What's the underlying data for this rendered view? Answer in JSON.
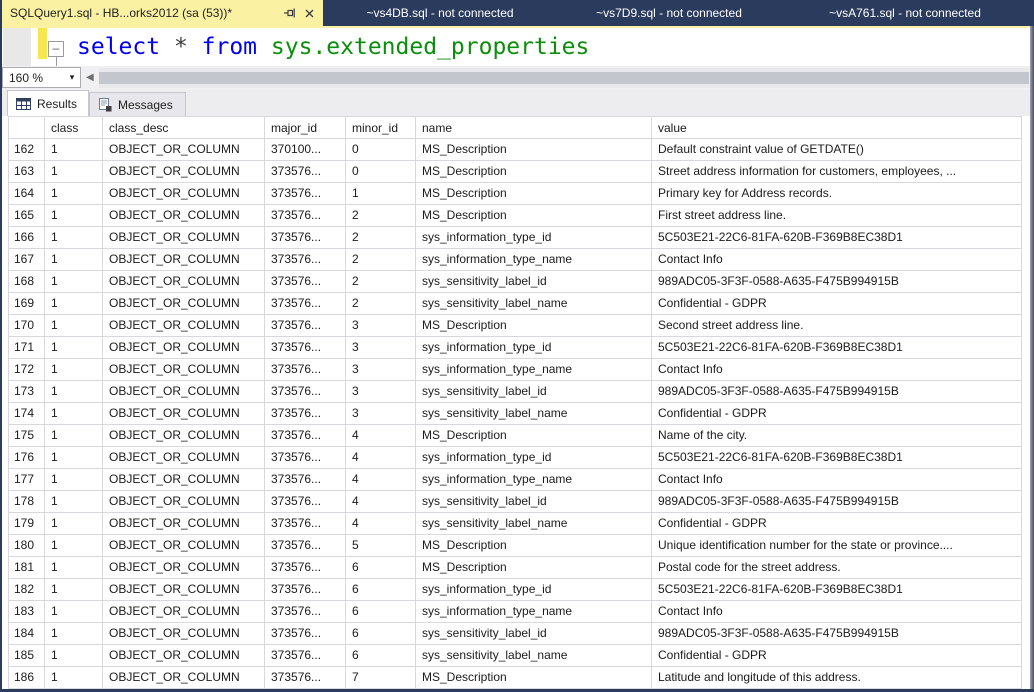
{
  "tab_bar": {
    "tabs": [
      {
        "label": "SQLQuery1.sql - HB...orks2012 (sa (53))*",
        "active": true
      },
      {
        "label": "~vs4DB.sql - not connected",
        "active": false
      },
      {
        "label": "~vs7D9.sql - not connected",
        "active": false
      },
      {
        "label": "~vsA761.sql - not connected",
        "active": false
      }
    ]
  },
  "editor": {
    "code_tokens": {
      "kw_select": "select",
      "star": " * ",
      "kw_from": "from",
      "space": " ",
      "system_object": "sys.extended_properties"
    },
    "zoom_value": "160 %"
  },
  "glyphs": {
    "dropdown_arrow": "▾",
    "scroll_left_arrow": "◀",
    "outline_collapse": "–"
  },
  "results_pane": {
    "results_tab_label": "Results",
    "messages_tab_label": "Messages"
  },
  "grid": {
    "columns": [
      "class",
      "class_desc",
      "major_id",
      "minor_id",
      "name",
      "value"
    ],
    "rows": [
      {
        "num": "162",
        "cells": [
          "1",
          "OBJECT_OR_COLUMN",
          "370100...",
          "0",
          "MS_Description",
          "Default constraint value of GETDATE()"
        ]
      },
      {
        "num": "163",
        "cells": [
          "1",
          "OBJECT_OR_COLUMN",
          "373576...",
          "0",
          "MS_Description",
          "Street address information for customers, employees, ..."
        ]
      },
      {
        "num": "164",
        "cells": [
          "1",
          "OBJECT_OR_COLUMN",
          "373576...",
          "1",
          "MS_Description",
          "Primary key for Address records."
        ]
      },
      {
        "num": "165",
        "cells": [
          "1",
          "OBJECT_OR_COLUMN",
          "373576...",
          "2",
          "MS_Description",
          "First street address line."
        ]
      },
      {
        "num": "166",
        "cells": [
          "1",
          "OBJECT_OR_COLUMN",
          "373576...",
          "2",
          "sys_information_type_id",
          "5C503E21-22C6-81FA-620B-F369B8EC38D1"
        ]
      },
      {
        "num": "167",
        "cells": [
          "1",
          "OBJECT_OR_COLUMN",
          "373576...",
          "2",
          "sys_information_type_name",
          "Contact Info"
        ]
      },
      {
        "num": "168",
        "cells": [
          "1",
          "OBJECT_OR_COLUMN",
          "373576...",
          "2",
          "sys_sensitivity_label_id",
          "989ADC05-3F3F-0588-A635-F475B994915B"
        ]
      },
      {
        "num": "169",
        "cells": [
          "1",
          "OBJECT_OR_COLUMN",
          "373576...",
          "2",
          "sys_sensitivity_label_name",
          "Confidential - GDPR"
        ]
      },
      {
        "num": "170",
        "cells": [
          "1",
          "OBJECT_OR_COLUMN",
          "373576...",
          "3",
          "MS_Description",
          "Second street address line."
        ]
      },
      {
        "num": "171",
        "cells": [
          "1",
          "OBJECT_OR_COLUMN",
          "373576...",
          "3",
          "sys_information_type_id",
          "5C503E21-22C6-81FA-620B-F369B8EC38D1"
        ]
      },
      {
        "num": "172",
        "cells": [
          "1",
          "OBJECT_OR_COLUMN",
          "373576...",
          "3",
          "sys_information_type_name",
          "Contact Info"
        ]
      },
      {
        "num": "173",
        "cells": [
          "1",
          "OBJECT_OR_COLUMN",
          "373576...",
          "3",
          "sys_sensitivity_label_id",
          "989ADC05-3F3F-0588-A635-F475B994915B"
        ]
      },
      {
        "num": "174",
        "cells": [
          "1",
          "OBJECT_OR_COLUMN",
          "373576...",
          "3",
          "sys_sensitivity_label_name",
          "Confidential - GDPR"
        ]
      },
      {
        "num": "175",
        "cells": [
          "1",
          "OBJECT_OR_COLUMN",
          "373576...",
          "4",
          "MS_Description",
          "Name of the city."
        ]
      },
      {
        "num": "176",
        "cells": [
          "1",
          "OBJECT_OR_COLUMN",
          "373576...",
          "4",
          "sys_information_type_id",
          "5C503E21-22C6-81FA-620B-F369B8EC38D1"
        ]
      },
      {
        "num": "177",
        "cells": [
          "1",
          "OBJECT_OR_COLUMN",
          "373576...",
          "4",
          "sys_information_type_name",
          "Contact Info"
        ]
      },
      {
        "num": "178",
        "cells": [
          "1",
          "OBJECT_OR_COLUMN",
          "373576...",
          "4",
          "sys_sensitivity_label_id",
          "989ADC05-3F3F-0588-A635-F475B994915B"
        ]
      },
      {
        "num": "179",
        "cells": [
          "1",
          "OBJECT_OR_COLUMN",
          "373576...",
          "4",
          "sys_sensitivity_label_name",
          "Confidential - GDPR"
        ]
      },
      {
        "num": "180",
        "cells": [
          "1",
          "OBJECT_OR_COLUMN",
          "373576...",
          "5",
          "MS_Description",
          "Unique identification number for the state or province...."
        ]
      },
      {
        "num": "181",
        "cells": [
          "1",
          "OBJECT_OR_COLUMN",
          "373576...",
          "6",
          "MS_Description",
          "Postal code for the street address."
        ]
      },
      {
        "num": "182",
        "cells": [
          "1",
          "OBJECT_OR_COLUMN",
          "373576...",
          "6",
          "sys_information_type_id",
          "5C503E21-22C6-81FA-620B-F369B8EC38D1"
        ]
      },
      {
        "num": "183",
        "cells": [
          "1",
          "OBJECT_OR_COLUMN",
          "373576...",
          "6",
          "sys_information_type_name",
          "Contact Info"
        ]
      },
      {
        "num": "184",
        "cells": [
          "1",
          "OBJECT_OR_COLUMN",
          "373576...",
          "6",
          "sys_sensitivity_label_id",
          "989ADC05-3F3F-0588-A635-F475B994915B"
        ]
      },
      {
        "num": "185",
        "cells": [
          "1",
          "OBJECT_OR_COLUMN",
          "373576...",
          "6",
          "sys_sensitivity_label_name",
          "Confidential - GDPR"
        ]
      },
      {
        "num": "186",
        "cells": [
          "1",
          "OBJECT_OR_COLUMN",
          "373576...",
          "7",
          "MS_Description",
          "Latitude and longitude of this address."
        ]
      }
    ]
  },
  "colors": {
    "window_chrome": "#2B3B5E",
    "active_tab": "#FBF1A3",
    "change_tracking_bar": "#F5E74F",
    "keyword_blue": "#0000F0",
    "system_object_green": "#0A8F0A",
    "gridline": "#D8D8DC",
    "scrollbar_thumb": "#C3C6CD"
  }
}
